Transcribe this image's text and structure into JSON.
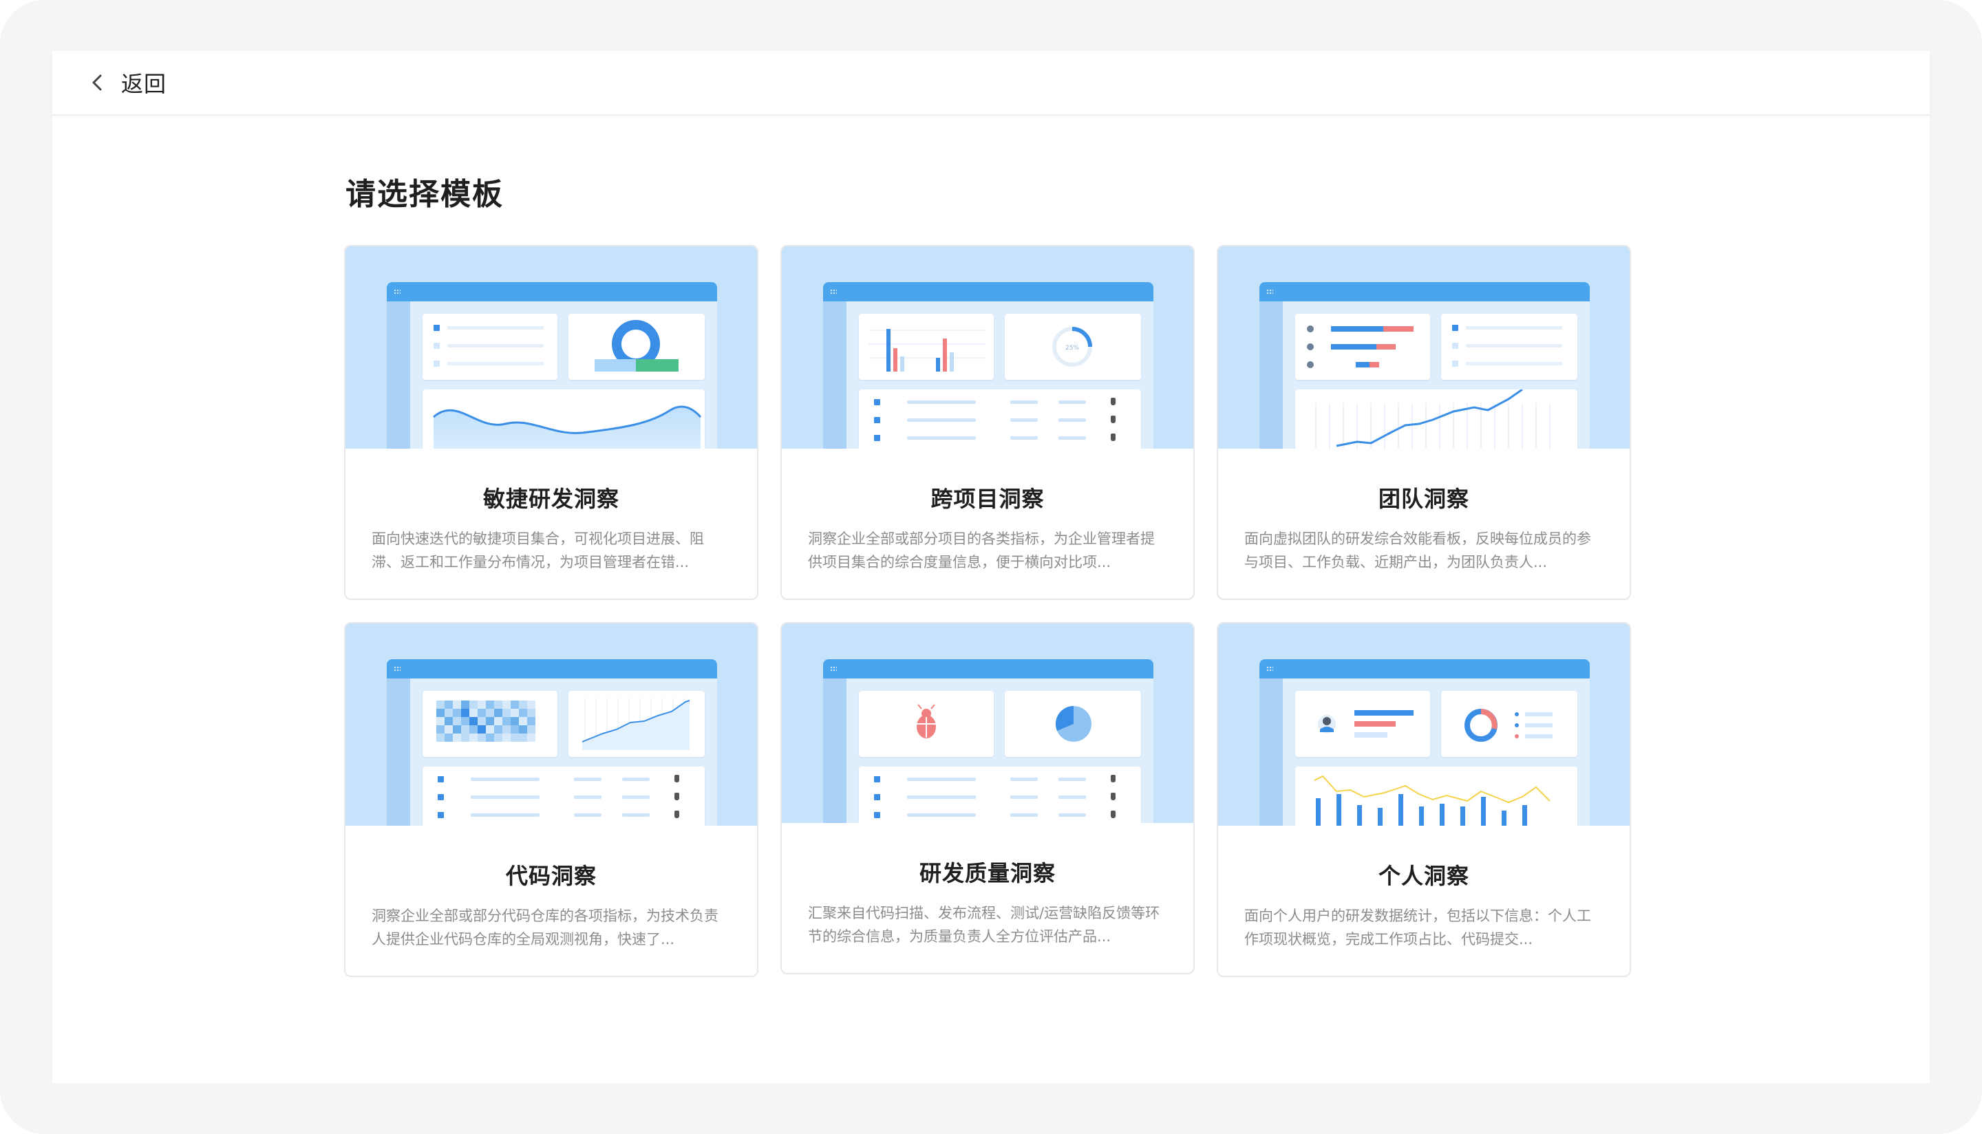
{
  "header": {
    "back_label": "返回"
  },
  "page": {
    "title": "请选择模板"
  },
  "templates": [
    {
      "title": "敏捷研发洞察",
      "description": "面向快速迭代的敏捷项目集合，可视化项目进展、阻滞、返工和工作量分布情况，为项目管理者在错..."
    },
    {
      "title": "跨项目洞察",
      "description": "洞察企业全部或部分项目的各类指标，为企业管理者提供项目集合的综合度量信息，便于横向对比项..."
    },
    {
      "title": "团队洞察",
      "description": "面向虚拟团队的研发综合效能看板，反映每位成员的参与项目、工作负载、近期产出，为团队负责人..."
    },
    {
      "title": "代码洞察",
      "description": "洞察企业全部或部分代码仓库的各项指标，为技术负责人提供企业代码仓库的全局观测视角，快速了..."
    },
    {
      "title": "研发质量洞察",
      "description": "汇聚来自代码扫描、发布流程、测试/运营缺陷反馈等环节的综合信息，为质量负责人全方位评估产品..."
    },
    {
      "title": "个人洞察",
      "description": "面向个人用户的研发数据统计，包括以下信息：个人工作项现状概览，完成工作项占比、代码提交..."
    }
  ],
  "thumbnails": {
    "donut_label": "25%"
  },
  "colors": {
    "accent": "#3a8ee6",
    "preview_bg": "#c7e3fb",
    "mock_header": "#4aa5ec",
    "red": "#f08080",
    "green": "#4cc08a",
    "yellow": "#f5d24a"
  }
}
